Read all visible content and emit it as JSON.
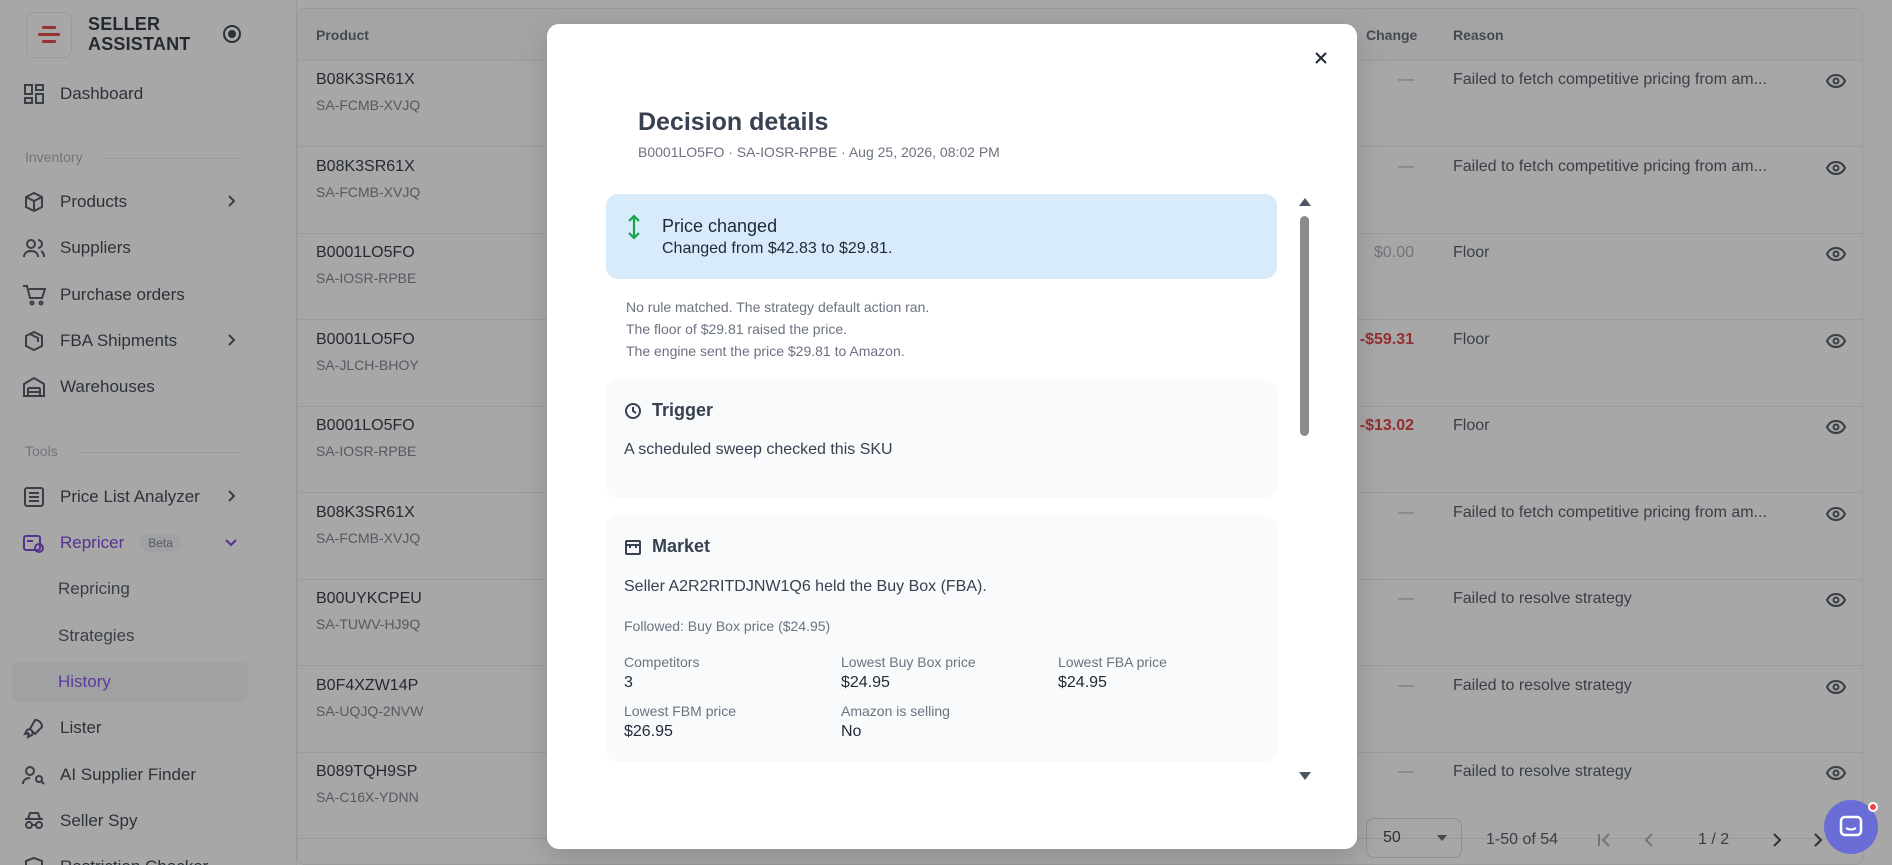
{
  "brand": {
    "line1": "SELLER",
    "line2": "ASSISTANT"
  },
  "sidebar": {
    "dashboard": "Dashboard",
    "inventory_label": "Inventory",
    "products": "Products",
    "suppliers": "Suppliers",
    "purchase_orders": "Purchase orders",
    "fba_shipments": "FBA Shipments",
    "warehouses": "Warehouses",
    "tools_label": "Tools",
    "price_list_analyzer": "Price List Analyzer",
    "repricer": "Repricer",
    "repricer_badge": "Beta",
    "repricing": "Repricing",
    "strategies": "Strategies",
    "history": "History",
    "lister": "Lister",
    "ai_supplier_finder": "AI Supplier Finder",
    "seller_spy": "Seller Spy",
    "restriction_checker": "Restriction Checker"
  },
  "table": {
    "headers": {
      "product": "Product",
      "change": "Change",
      "reason": "Reason"
    },
    "rows": [
      {
        "asin": "B08K3SR61X",
        "sku": "SA-FCMB-XVJQ",
        "change": "—",
        "change_style": "gray",
        "reason": "Failed to fetch competitive pricing from am..."
      },
      {
        "asin": "B08K3SR61X",
        "sku": "SA-FCMB-XVJQ",
        "change": "—",
        "change_style": "gray",
        "reason": "Failed to fetch competitive pricing from am..."
      },
      {
        "asin": "B0001LO5FO",
        "sku": "SA-IOSR-RPBE",
        "change": "$0.00",
        "change_style": "gray",
        "reason": "Floor"
      },
      {
        "asin": "B0001LO5FO",
        "sku": "SA-JLCH-BHOY",
        "change": "-$59.31",
        "change_style": "red",
        "reason": "Floor"
      },
      {
        "asin": "B0001LO5FO",
        "sku": "SA-IOSR-RPBE",
        "change": "-$13.02",
        "change_style": "red",
        "reason": "Floor"
      },
      {
        "asin": "B08K3SR61X",
        "sku": "SA-FCMB-XVJQ",
        "change": "—",
        "change_style": "gray",
        "reason": "Failed to fetch competitive pricing from am..."
      },
      {
        "asin": "B00UYKCPEU",
        "sku": "SA-TUWV-HJ9Q",
        "change": "—",
        "change_style": "gray",
        "reason": "Failed to resolve strategy"
      },
      {
        "asin": "B0F4XZW14P",
        "sku": "SA-UQJQ-2NVW",
        "change": "—",
        "change_style": "gray",
        "reason": "Failed to resolve strategy"
      },
      {
        "asin": "B089TQH9SP",
        "sku": "SA-C16X-YDNN",
        "change": "—",
        "change_style": "gray",
        "reason": "Failed to resolve strategy"
      }
    ],
    "pager": {
      "per_page": "50",
      "range": "1-50 of 54",
      "page": "1 / 2"
    }
  },
  "modal": {
    "title": "Decision details",
    "subtitle": "B0001LO5FO · SA-IOSR-RPBE · Aug 25, 2026, 08:02 PM",
    "banner": {
      "title": "Price changed",
      "text": "Changed from $42.83 to $29.81."
    },
    "notes": [
      "No rule matched. The strategy default action ran.",
      "The floor of $29.81 raised the price.",
      "The engine sent the price $29.81 to Amazon."
    ],
    "trigger": {
      "title": "Trigger",
      "text": "A scheduled sweep checked this SKU"
    },
    "market": {
      "title": "Market",
      "text": "Seller A2R2RITDJNW1Q6 held the Buy Box (FBA).",
      "followed": "Followed: Buy Box price ($24.95)",
      "stats": [
        {
          "label": "Competitors",
          "value": "3"
        },
        {
          "label": "Lowest Buy Box price",
          "value": "$24.95"
        },
        {
          "label": "Lowest FBA price",
          "value": "$24.95"
        },
        {
          "label": "Lowest FBM price",
          "value": "$26.95"
        },
        {
          "label": "Amazon is selling",
          "value": "No"
        }
      ]
    }
  },
  "colors": {
    "accent": "#7c3aed",
    "brand_red": "#e02d2d",
    "banner": "#d7ebfb",
    "negative": "#dc2626"
  }
}
